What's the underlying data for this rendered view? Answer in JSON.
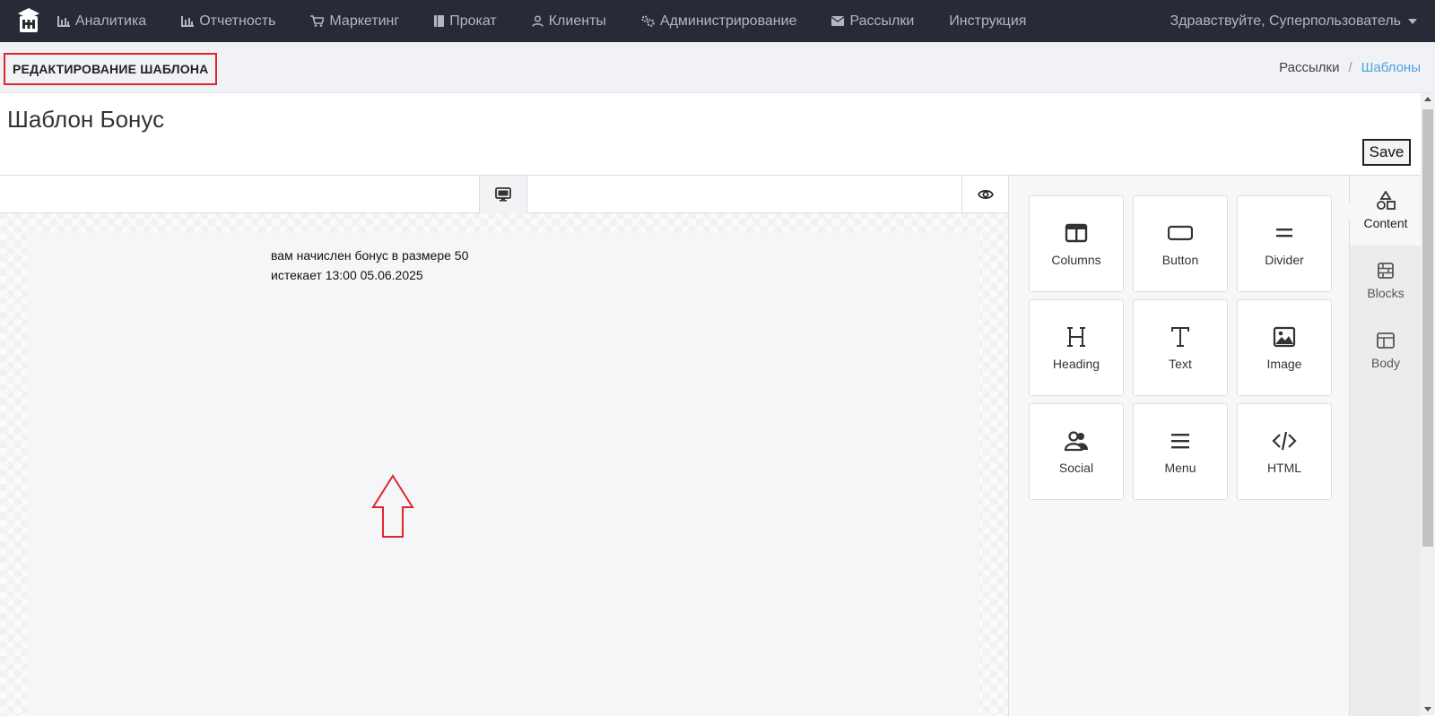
{
  "nav": {
    "items": [
      {
        "label": "Аналитика",
        "icon": "bar-chart-icon"
      },
      {
        "label": "Отчетность",
        "icon": "bar-chart-icon"
      },
      {
        "label": "Маркетинг",
        "icon": "cart-icon"
      },
      {
        "label": "Прокат",
        "icon": "book-icon"
      },
      {
        "label": "Клиенты",
        "icon": "user-icon"
      },
      {
        "label": "Администрирование",
        "icon": "gears-icon"
      },
      {
        "label": "Рассылки",
        "icon": "envelope-icon"
      },
      {
        "label": "Инструкция",
        "icon": ""
      }
    ],
    "greeting": "Здравствуйте, Суперпользователь"
  },
  "header": {
    "page_heading": "РЕДАКТИРОВАНИЕ ШАБЛОНА",
    "breadcrumb": {
      "parent": "Рассылки",
      "separator": "/",
      "current": "Шаблоны"
    }
  },
  "template": {
    "title": "Шаблон Бонус",
    "save_label": "Save"
  },
  "canvas": {
    "line1": "вам начислен бонус в размере 50",
    "line2": "истекает 13:00 05.06.2025"
  },
  "tools": [
    {
      "label": "Columns",
      "icon": "columns-icon"
    },
    {
      "label": "Button",
      "icon": "button-icon"
    },
    {
      "label": "Divider",
      "icon": "divider-icon"
    },
    {
      "label": "Heading",
      "icon": "heading-icon"
    },
    {
      "label": "Text",
      "icon": "text-icon"
    },
    {
      "label": "Image",
      "icon": "image-icon"
    },
    {
      "label": "Social",
      "icon": "social-icon"
    },
    {
      "label": "Menu",
      "icon": "menu-icon"
    },
    {
      "label": "HTML",
      "icon": "code-icon"
    }
  ],
  "side_tabs": [
    {
      "label": "Content",
      "icon": "shapes-icon",
      "active": true
    },
    {
      "label": "Blocks",
      "icon": "blocks-icon",
      "active": false
    },
    {
      "label": "Body",
      "icon": "layout-icon",
      "active": false
    }
  ],
  "colors": {
    "nav_bg": "#272a37",
    "nav_text": "#b4b7c2",
    "heading_outline": "#e0242b",
    "breadcrumb_link": "#4aa3df",
    "annotation_arrow": "#e0242b"
  }
}
